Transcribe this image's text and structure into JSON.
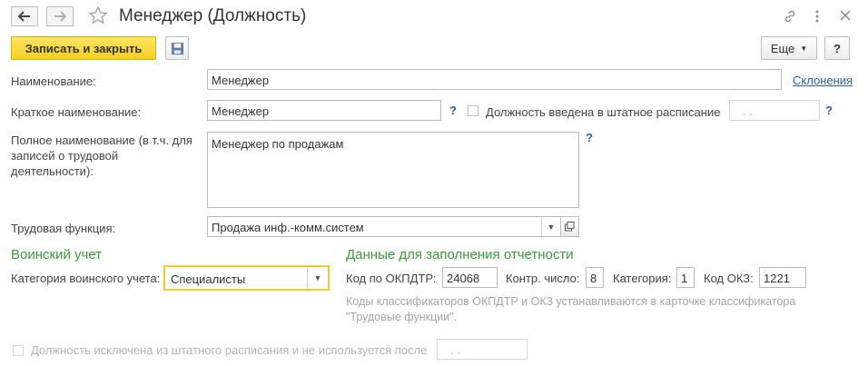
{
  "window": {
    "title": "Менеджер (Должность)"
  },
  "toolbar": {
    "save_close_label": "Записать и закрыть",
    "more_label": "Еще",
    "help_label": "?"
  },
  "form": {
    "name_label": "Наименование:",
    "name_value": "Менеджер",
    "declensions_link": "Склонения",
    "short_name_label": "Краткое наименование:",
    "short_name_value": "Менеджер",
    "short_help": "?",
    "in_schedule_label": "Должность введена в штатное расписание",
    "in_schedule_date": ". .",
    "in_schedule_help": "?",
    "full_name_label": "Полное наименование (в т.ч. для записей о трудовой деятельности):",
    "full_name_value": "Менеджер по продажам",
    "full_name_help": "?",
    "labor_function_label": "Трудовая функция:",
    "labor_function_value": "Продажа инф.-комм.систем"
  },
  "military": {
    "section_title": "Воинский учет",
    "category_label": "Категория воинского учета:",
    "category_value": "Специалисты"
  },
  "reporting": {
    "section_title": "Данные для заполнения отчетности",
    "okpdtr_label": "Код по ОКПДТР:",
    "okpdtr_value": "24068",
    "control_label": "Контр. число:",
    "control_value": "8",
    "category_label": "Категория:",
    "category_value": "1",
    "okz_label": "Код ОКЗ:",
    "okz_value": "1221",
    "hint_line1": "Коды классификаторов ОКПДТР и ОКЗ устанавливаются в карточке классификатора",
    "hint_line2": "\"Трудовые функции\"."
  },
  "footer": {
    "excluded_label": "Должность исключена из штатного расписания и не используется после",
    "excluded_date": ". ."
  },
  "colors": {
    "accent_yellow": "#f5cf1f",
    "section_green": "#3c9a3c",
    "link_blue": "#2a62ad"
  }
}
